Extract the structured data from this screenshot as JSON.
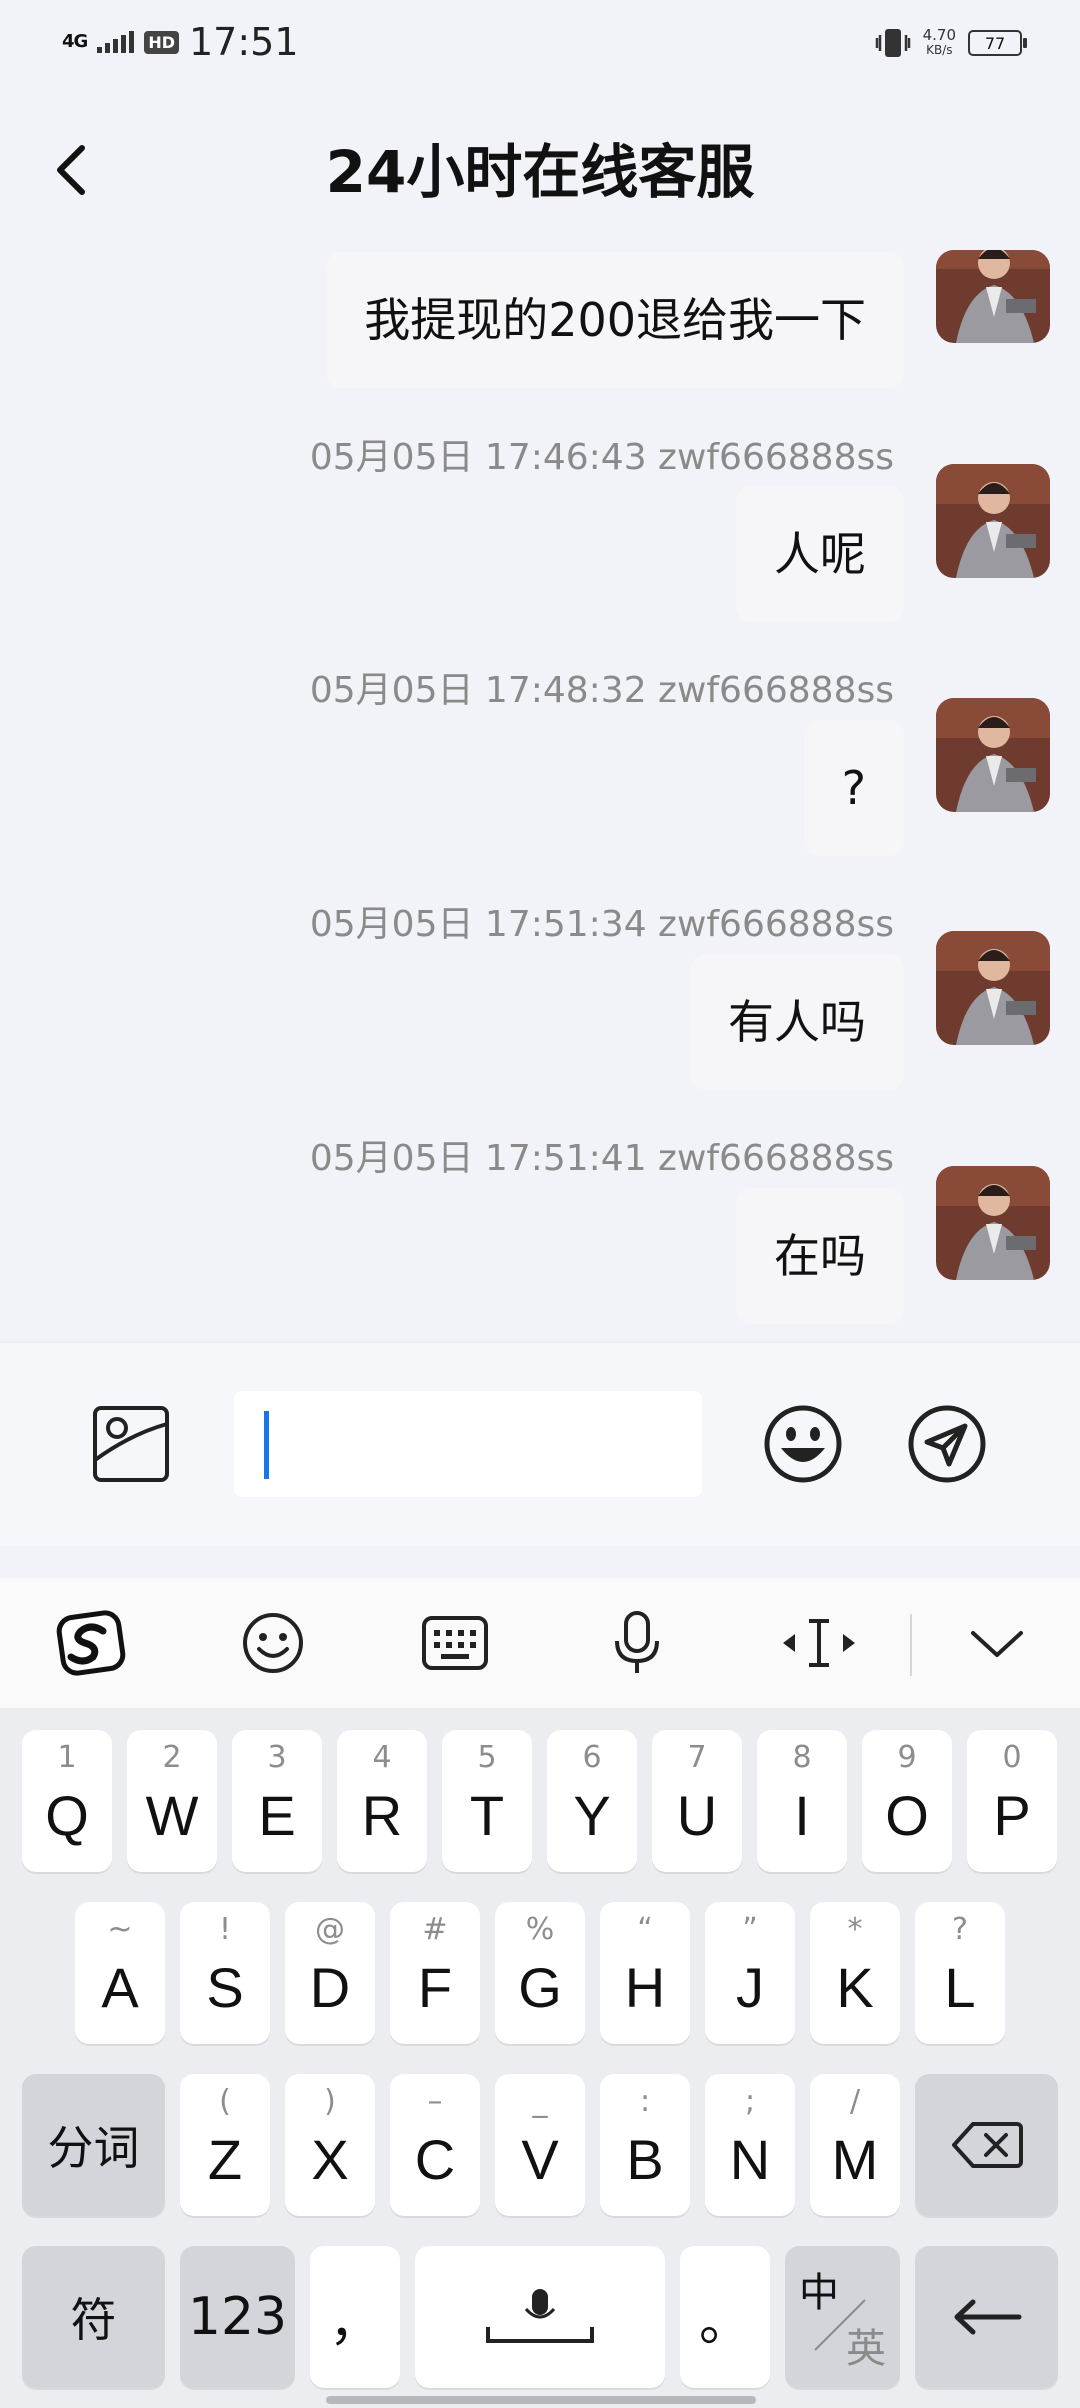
{
  "status": {
    "network": "4G",
    "hd": "HD",
    "time": "17:51",
    "speed_value": "4.70",
    "speed_unit": "KB/s",
    "battery": "77"
  },
  "header": {
    "title": "24小时在线客服",
    "back_icon": "chevron-left-icon"
  },
  "messages": [
    {
      "text": "我提现的200退给我一下",
      "meta": ""
    },
    {
      "text": "人呢",
      "meta": "05月05日 17:46:43 zwf666888ss"
    },
    {
      "text": "?",
      "meta": "05月05日 17:48:32 zwf666888ss"
    },
    {
      "text": "有人吗",
      "meta": "05月05日 17:51:34 zwf666888ss"
    },
    {
      "text": "在吗",
      "meta": "05月05日 17:51:41 zwf666888ss"
    }
  ],
  "composer": {
    "input_value": "",
    "image_icon": "image-icon",
    "emoji_icon": "emoji-icon",
    "send_icon": "send-icon"
  },
  "keyboard": {
    "toolbar": [
      "sogou-logo-icon",
      "emoji-icon",
      "keyboard-icon",
      "microphone-icon",
      "cursor-move-icon",
      "chevron-down-icon"
    ],
    "row1": [
      {
        "hint": "1",
        "key": "Q"
      },
      {
        "hint": "2",
        "key": "W"
      },
      {
        "hint": "3",
        "key": "E"
      },
      {
        "hint": "4",
        "key": "R"
      },
      {
        "hint": "5",
        "key": "T"
      },
      {
        "hint": "6",
        "key": "Y"
      },
      {
        "hint": "7",
        "key": "U"
      },
      {
        "hint": "8",
        "key": "I"
      },
      {
        "hint": "9",
        "key": "O"
      },
      {
        "hint": "0",
        "key": "P"
      }
    ],
    "row2": [
      {
        "hint": "~",
        "key": "A"
      },
      {
        "hint": "!",
        "key": "S"
      },
      {
        "hint": "@",
        "key": "D"
      },
      {
        "hint": "#",
        "key": "F"
      },
      {
        "hint": "%",
        "key": "G"
      },
      {
        "hint": "“",
        "key": "H"
      },
      {
        "hint": "”",
        "key": "J"
      },
      {
        "hint": "*",
        "key": "K"
      },
      {
        "hint": "?",
        "key": "L"
      }
    ],
    "row3": [
      {
        "hint": "(",
        "key": "Z"
      },
      {
        "hint": ")",
        "key": "X"
      },
      {
        "hint": "–",
        "key": "C"
      },
      {
        "hint": "_",
        "key": "V"
      },
      {
        "hint": ":",
        "key": "B"
      },
      {
        "hint": ";",
        "key": "N"
      },
      {
        "hint": "/",
        "key": "M"
      }
    ],
    "fenci": "分词",
    "fu": "符",
    "num": "123",
    "comma": "，",
    "period": "。",
    "zh": "中",
    "en": "英"
  }
}
